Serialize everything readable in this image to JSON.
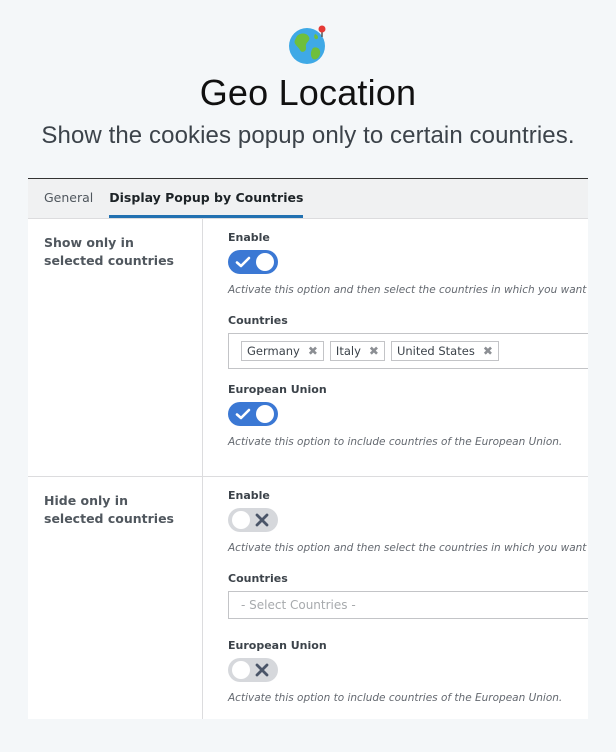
{
  "header": {
    "title": "Geo Location",
    "subtitle": "Show the cookies popup only to certain countries.",
    "icon": "globe-icon"
  },
  "tabs": [
    {
      "label": "General",
      "active": false
    },
    {
      "label": "Display Popup by Countries",
      "active": true
    }
  ],
  "sections": [
    {
      "label": "Show only in selected countries",
      "enable_label": "Enable",
      "enable_on": true,
      "enable_desc": "Activate this option and then select the countries in which you want",
      "countries_label": "Countries",
      "countries": [
        "Germany",
        "Italy",
        "United States"
      ],
      "countries_placeholder": "",
      "eu_label": "European Union",
      "eu_on": true,
      "eu_desc": "Activate this option to include countries of the European Union."
    },
    {
      "label": "Hide only in selected countries",
      "enable_label": "Enable",
      "enable_on": false,
      "enable_desc": "Activate this option and then select the countries in which you want",
      "countries_label": "Countries",
      "countries": [],
      "countries_placeholder": "- Select Countries -",
      "eu_label": "European Union",
      "eu_on": false,
      "eu_desc": "Activate this option to include countries of the European Union."
    }
  ],
  "colors": {
    "accent": "#3b78d4",
    "toggle_off": "#d6d8dc"
  }
}
